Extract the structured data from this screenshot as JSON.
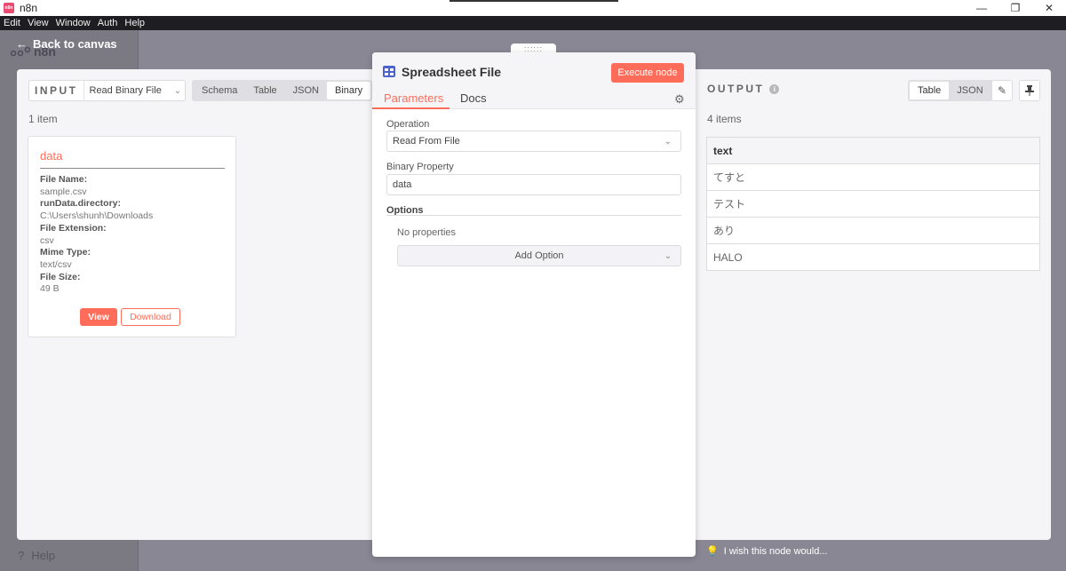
{
  "app": {
    "title": "n8n",
    "icon_label": "n8n",
    "menu": [
      "Edit",
      "View",
      "Window",
      "Auth",
      "Help"
    ],
    "window_controls": [
      "—",
      "❐",
      "✕"
    ]
  },
  "background": {
    "logo": "n8n",
    "help_label": "Help"
  },
  "nav": {
    "back_label": "Back to canvas"
  },
  "input_pane": {
    "label": "INPUT",
    "node_name": "Read Binary File",
    "modes": [
      "Schema",
      "Table",
      "JSON",
      "Binary"
    ],
    "active_mode": "Binary",
    "item_count": "1 item",
    "binary": {
      "title": "data",
      "fields": [
        {
          "key": "File Name:",
          "value": "sample.csv"
        },
        {
          "key": "runData.directory:",
          "value": "C:\\Users\\shunh\\Downloads"
        },
        {
          "key": "File Extension:",
          "value": "csv"
        },
        {
          "key": "Mime Type:",
          "value": "text/csv"
        },
        {
          "key": "File Size:",
          "value": "49 B"
        }
      ],
      "view_label": "View",
      "download_label": "Download"
    }
  },
  "node_panel": {
    "handle": "::::::",
    "title": "Spreadsheet File",
    "execute_label": "Execute node",
    "tabs": [
      "Parameters",
      "Docs"
    ],
    "active_tab": "Parameters",
    "operation_label": "Operation",
    "operation_value": "Read From File",
    "binary_property_label": "Binary Property",
    "binary_property_value": "data",
    "options_label": "Options",
    "no_properties": "No properties",
    "add_option_label": "Add Option"
  },
  "output_pane": {
    "label": "OUTPUT",
    "item_count": "4 items",
    "modes": [
      "Table",
      "JSON"
    ],
    "active_mode": "Table",
    "column": "text",
    "rows": [
      "てすと",
      "テスト",
      "あり",
      "HALO"
    ]
  },
  "feedback": {
    "label": "I wish this node would..."
  },
  "colors": {
    "accent": "#ff6d5a",
    "node_icon": "#4b63cf"
  }
}
